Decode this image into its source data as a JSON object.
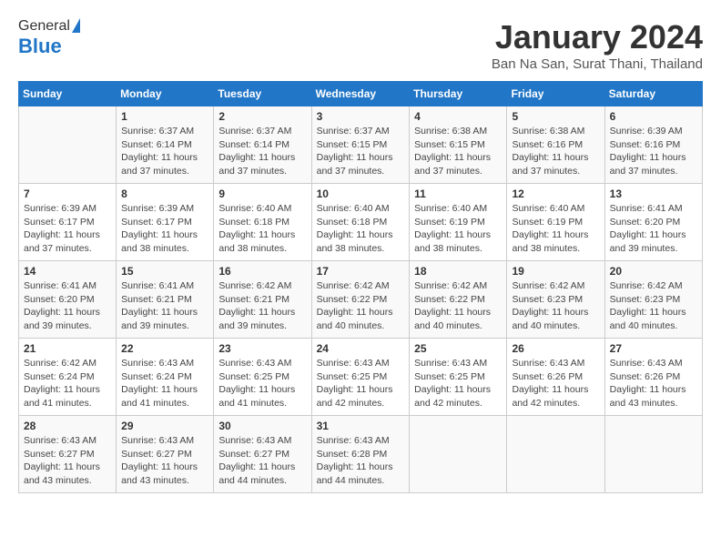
{
  "logo": {
    "general": "General",
    "blue": "Blue"
  },
  "title": "January 2024",
  "subtitle": "Ban Na San, Surat Thani, Thailand",
  "days_of_week": [
    "Sunday",
    "Monday",
    "Tuesday",
    "Wednesday",
    "Thursday",
    "Friday",
    "Saturday"
  ],
  "weeks": [
    [
      {
        "num": "",
        "info": ""
      },
      {
        "num": "1",
        "info": "Sunrise: 6:37 AM\nSunset: 6:14 PM\nDaylight: 11 hours\nand 37 minutes."
      },
      {
        "num": "2",
        "info": "Sunrise: 6:37 AM\nSunset: 6:14 PM\nDaylight: 11 hours\nand 37 minutes."
      },
      {
        "num": "3",
        "info": "Sunrise: 6:37 AM\nSunset: 6:15 PM\nDaylight: 11 hours\nand 37 minutes."
      },
      {
        "num": "4",
        "info": "Sunrise: 6:38 AM\nSunset: 6:15 PM\nDaylight: 11 hours\nand 37 minutes."
      },
      {
        "num": "5",
        "info": "Sunrise: 6:38 AM\nSunset: 6:16 PM\nDaylight: 11 hours\nand 37 minutes."
      },
      {
        "num": "6",
        "info": "Sunrise: 6:39 AM\nSunset: 6:16 PM\nDaylight: 11 hours\nand 37 minutes."
      }
    ],
    [
      {
        "num": "7",
        "info": "Sunrise: 6:39 AM\nSunset: 6:17 PM\nDaylight: 11 hours\nand 37 minutes."
      },
      {
        "num": "8",
        "info": "Sunrise: 6:39 AM\nSunset: 6:17 PM\nDaylight: 11 hours\nand 38 minutes."
      },
      {
        "num": "9",
        "info": "Sunrise: 6:40 AM\nSunset: 6:18 PM\nDaylight: 11 hours\nand 38 minutes."
      },
      {
        "num": "10",
        "info": "Sunrise: 6:40 AM\nSunset: 6:18 PM\nDaylight: 11 hours\nand 38 minutes."
      },
      {
        "num": "11",
        "info": "Sunrise: 6:40 AM\nSunset: 6:19 PM\nDaylight: 11 hours\nand 38 minutes."
      },
      {
        "num": "12",
        "info": "Sunrise: 6:40 AM\nSunset: 6:19 PM\nDaylight: 11 hours\nand 38 minutes."
      },
      {
        "num": "13",
        "info": "Sunrise: 6:41 AM\nSunset: 6:20 PM\nDaylight: 11 hours\nand 39 minutes."
      }
    ],
    [
      {
        "num": "14",
        "info": "Sunrise: 6:41 AM\nSunset: 6:20 PM\nDaylight: 11 hours\nand 39 minutes."
      },
      {
        "num": "15",
        "info": "Sunrise: 6:41 AM\nSunset: 6:21 PM\nDaylight: 11 hours\nand 39 minutes."
      },
      {
        "num": "16",
        "info": "Sunrise: 6:42 AM\nSunset: 6:21 PM\nDaylight: 11 hours\nand 39 minutes."
      },
      {
        "num": "17",
        "info": "Sunrise: 6:42 AM\nSunset: 6:22 PM\nDaylight: 11 hours\nand 40 minutes."
      },
      {
        "num": "18",
        "info": "Sunrise: 6:42 AM\nSunset: 6:22 PM\nDaylight: 11 hours\nand 40 minutes."
      },
      {
        "num": "19",
        "info": "Sunrise: 6:42 AM\nSunset: 6:23 PM\nDaylight: 11 hours\nand 40 minutes."
      },
      {
        "num": "20",
        "info": "Sunrise: 6:42 AM\nSunset: 6:23 PM\nDaylight: 11 hours\nand 40 minutes."
      }
    ],
    [
      {
        "num": "21",
        "info": "Sunrise: 6:42 AM\nSunset: 6:24 PM\nDaylight: 11 hours\nand 41 minutes."
      },
      {
        "num": "22",
        "info": "Sunrise: 6:43 AM\nSunset: 6:24 PM\nDaylight: 11 hours\nand 41 minutes."
      },
      {
        "num": "23",
        "info": "Sunrise: 6:43 AM\nSunset: 6:25 PM\nDaylight: 11 hours\nand 41 minutes."
      },
      {
        "num": "24",
        "info": "Sunrise: 6:43 AM\nSunset: 6:25 PM\nDaylight: 11 hours\nand 42 minutes."
      },
      {
        "num": "25",
        "info": "Sunrise: 6:43 AM\nSunset: 6:25 PM\nDaylight: 11 hours\nand 42 minutes."
      },
      {
        "num": "26",
        "info": "Sunrise: 6:43 AM\nSunset: 6:26 PM\nDaylight: 11 hours\nand 42 minutes."
      },
      {
        "num": "27",
        "info": "Sunrise: 6:43 AM\nSunset: 6:26 PM\nDaylight: 11 hours\nand 43 minutes."
      }
    ],
    [
      {
        "num": "28",
        "info": "Sunrise: 6:43 AM\nSunset: 6:27 PM\nDaylight: 11 hours\nand 43 minutes."
      },
      {
        "num": "29",
        "info": "Sunrise: 6:43 AM\nSunset: 6:27 PM\nDaylight: 11 hours\nand 43 minutes."
      },
      {
        "num": "30",
        "info": "Sunrise: 6:43 AM\nSunset: 6:27 PM\nDaylight: 11 hours\nand 44 minutes."
      },
      {
        "num": "31",
        "info": "Sunrise: 6:43 AM\nSunset: 6:28 PM\nDaylight: 11 hours\nand 44 minutes."
      },
      {
        "num": "",
        "info": ""
      },
      {
        "num": "",
        "info": ""
      },
      {
        "num": "",
        "info": ""
      }
    ]
  ]
}
